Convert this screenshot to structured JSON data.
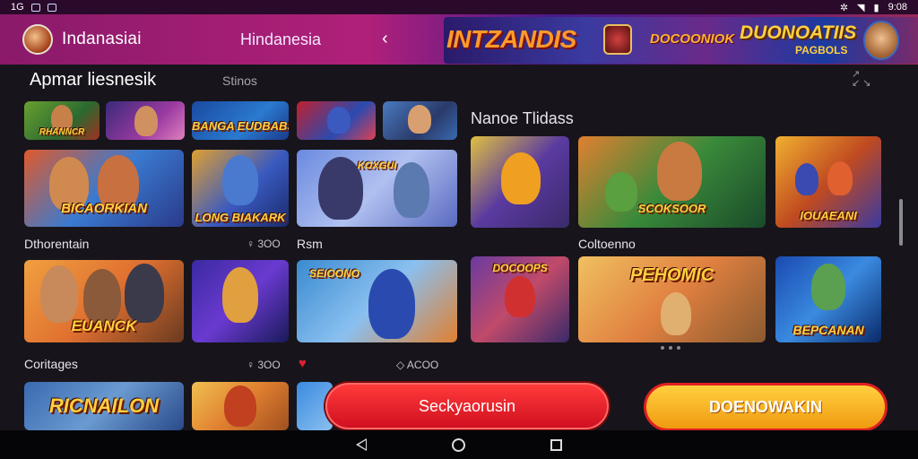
{
  "status_bar": {
    "left_text": "1G",
    "time": "9:08"
  },
  "header": {
    "brand": "Indanasiai",
    "region": "Hindanesia",
    "nav_prev": "‹",
    "banner": {
      "title": "INTZANDIS",
      "sub": "DOCOONIOK",
      "right_title": "DUONOATIIS",
      "right_sub": "PAGBOLS"
    }
  },
  "main": {
    "section_title": "Apmar liesnesik",
    "section_sub": "Stinos",
    "side_title": "Nanoe Tlidass",
    "row_labels": [
      {
        "label": "Dthorentain",
        "meta": "♀ 3OO"
      },
      {
        "label": "Rsm",
        "meta": ""
      },
      {
        "label": "Coltoenno",
        "meta": ""
      },
      {
        "label": "Coritages",
        "meta": "♀ 3OO"
      }
    ],
    "likes_meta": "◇ ACOO",
    "tiles": [
      {
        "name": "tile-1",
        "caption": "RHANNCR"
      },
      {
        "name": "tile-2",
        "caption": ""
      },
      {
        "name": "tile-3",
        "caption": "BANGA EUDBABS"
      },
      {
        "name": "tile-4",
        "caption": ""
      },
      {
        "name": "tile-5",
        "caption": ""
      },
      {
        "name": "tile-6",
        "caption": "BICAORKIAN"
      },
      {
        "name": "tile-7",
        "caption": "LONG BIAKARK"
      },
      {
        "name": "tile-8",
        "caption": "KOXGUI"
      },
      {
        "name": "tile-9",
        "caption": ""
      },
      {
        "name": "tile-10",
        "caption": "SCOKSOOR"
      },
      {
        "name": "tile-11",
        "caption": "IOUAEANI"
      },
      {
        "name": "tile-12",
        "caption": "EUANCK"
      },
      {
        "name": "tile-13",
        "caption": ""
      },
      {
        "name": "tile-14",
        "caption": "SEIOONO"
      },
      {
        "name": "tile-15",
        "caption": "DOCOOPS"
      },
      {
        "name": "tile-16",
        "caption": "PEHOMIC"
      },
      {
        "name": "tile-17",
        "caption": "BEPCANAN"
      },
      {
        "name": "tile-18",
        "caption": "RICNAILON"
      },
      {
        "name": "tile-19",
        "caption": ""
      },
      {
        "name": "tile-20",
        "caption": ""
      }
    ]
  },
  "buttons": {
    "primary": "Seckyaorusin",
    "secondary": "DOENOWAKIN"
  },
  "colors": {
    "accent_red": "#e01828",
    "accent_yellow": "#ffc030",
    "header_magenta": "#b0207a"
  }
}
